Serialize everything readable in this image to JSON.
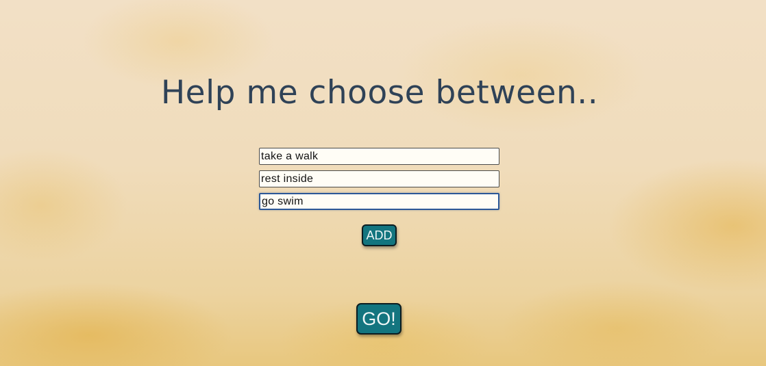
{
  "header": {
    "title": "Help me choose between.."
  },
  "choices": [
    {
      "value": "take a walk"
    },
    {
      "value": "rest inside"
    },
    {
      "value": "go swim"
    }
  ],
  "buttons": {
    "add_label": "ADD",
    "go_label": "GO!"
  },
  "colors": {
    "title": "#2f4257",
    "button_bg": "#13757f",
    "button_border": "#0c1c20",
    "input_bg": "#fffdf6",
    "focus_border": "#2b5797"
  }
}
